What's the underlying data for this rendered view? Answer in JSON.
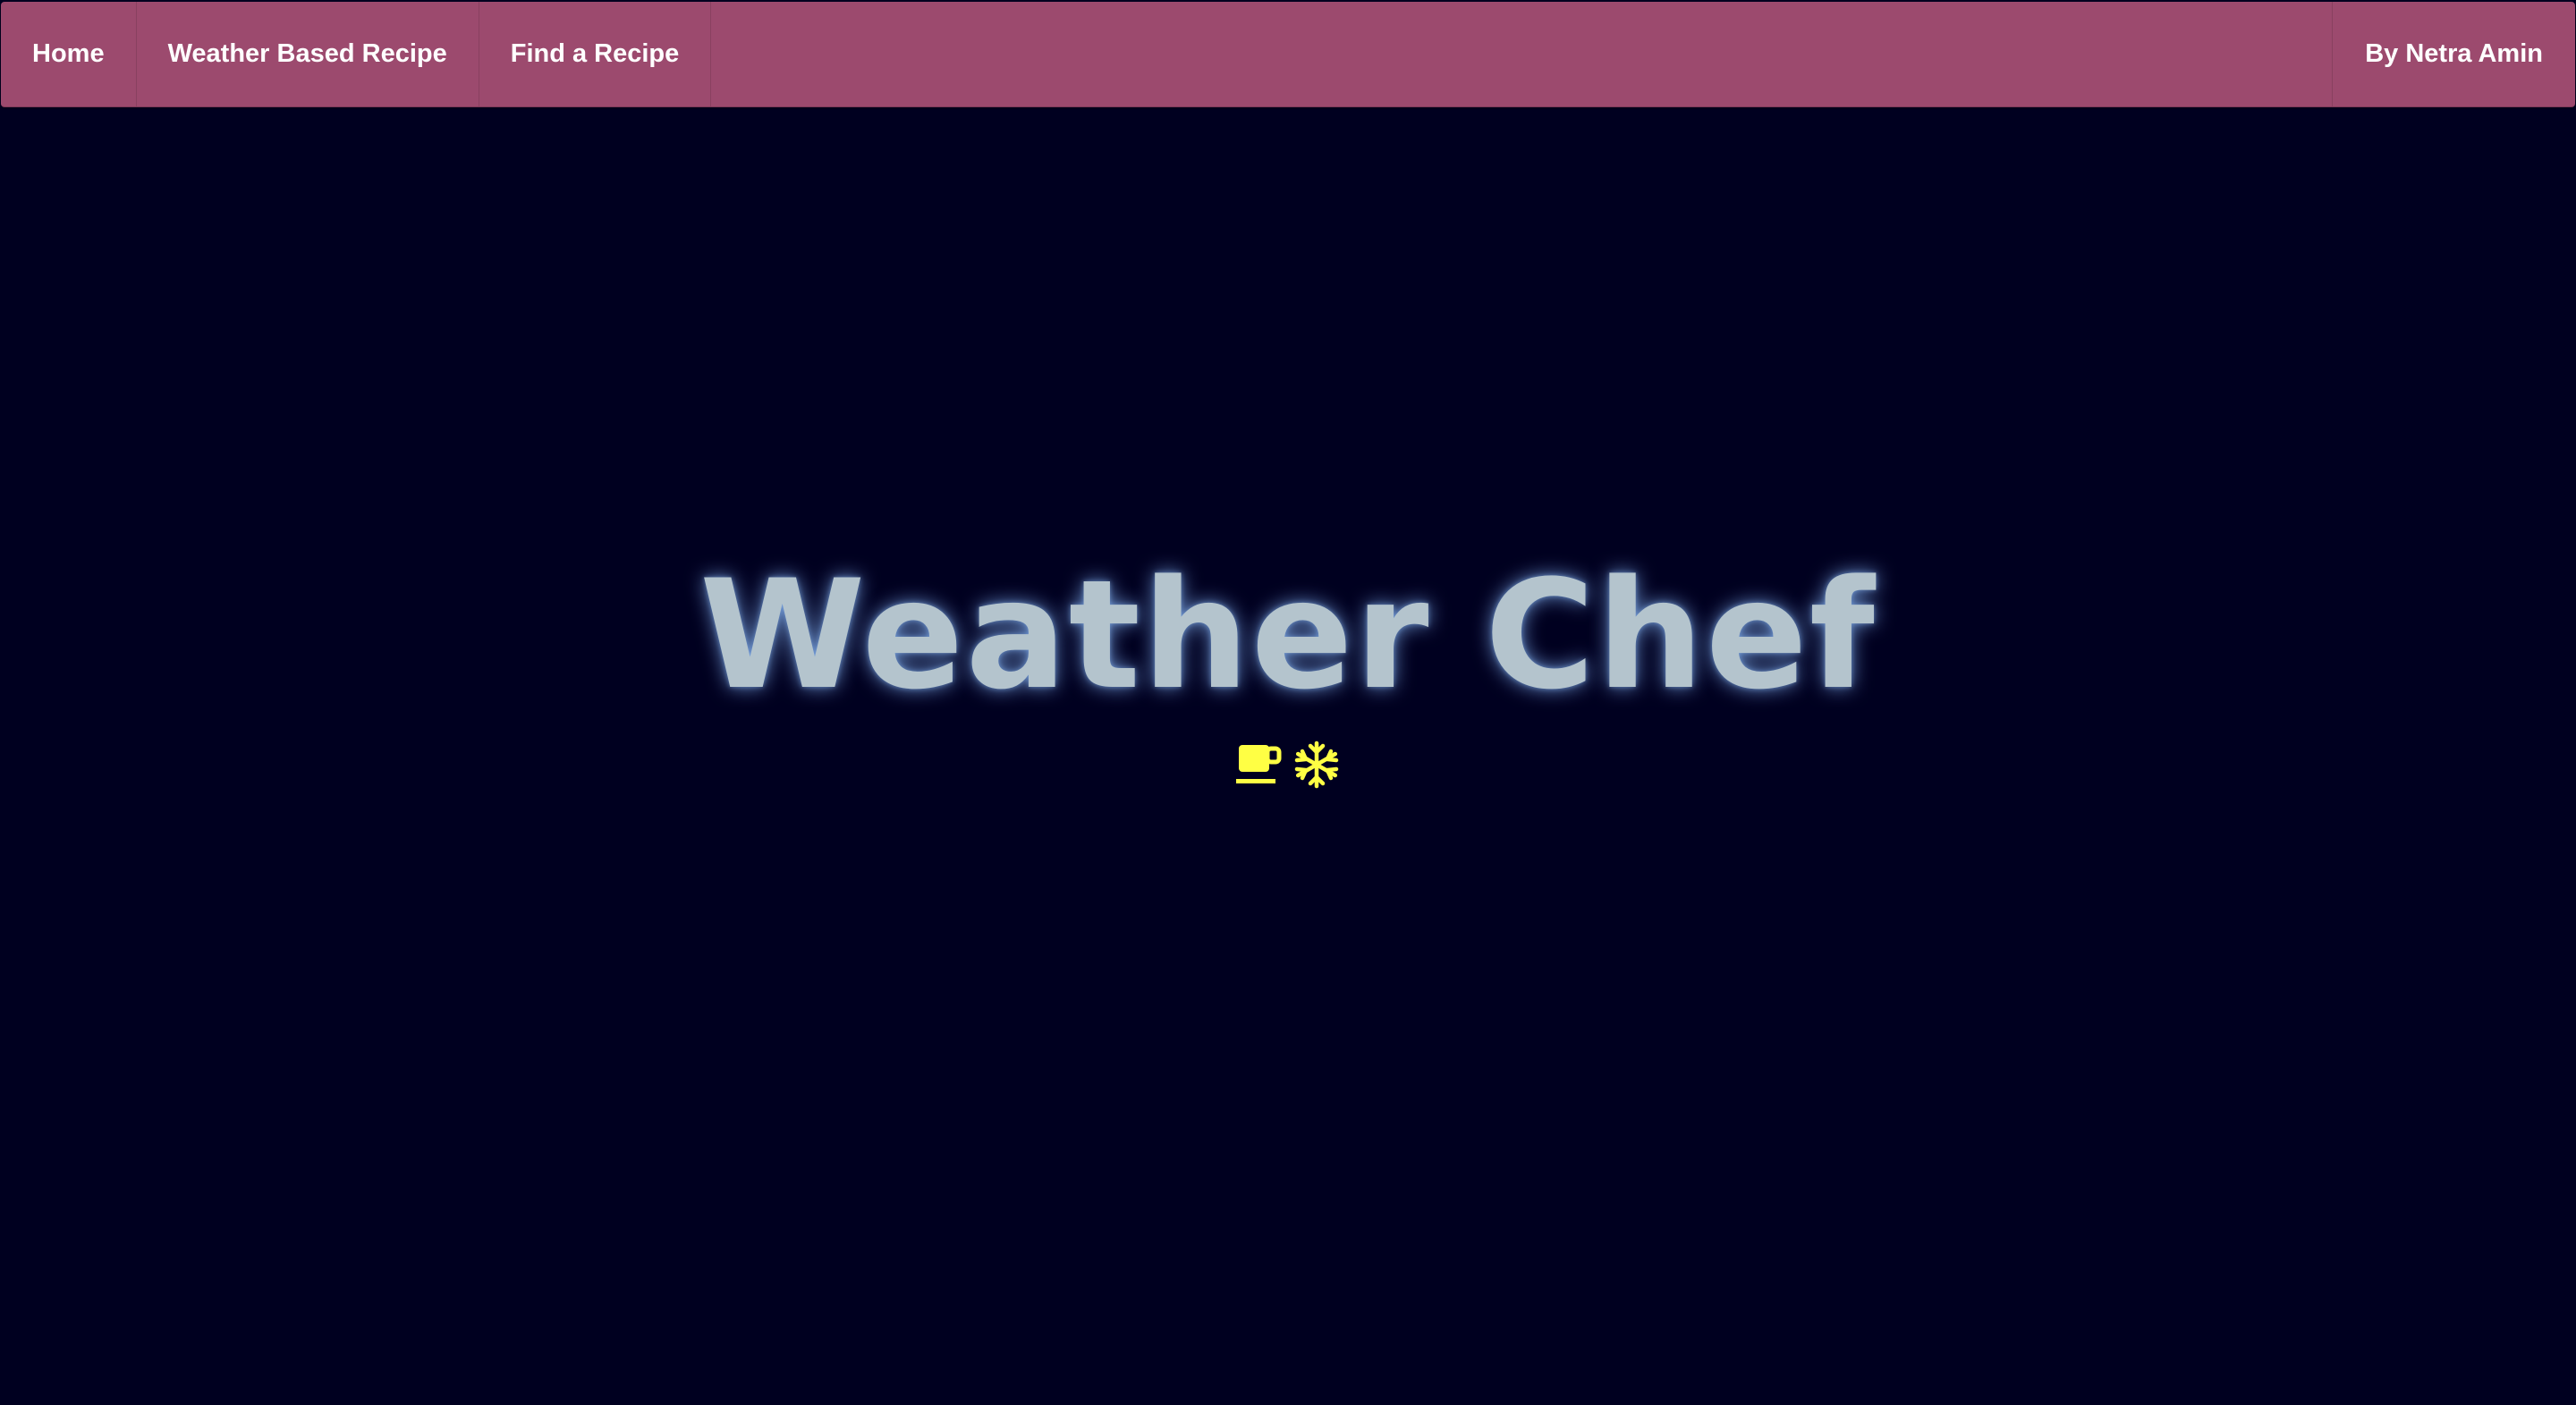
{
  "nav": {
    "items": [
      {
        "label": "Home"
      },
      {
        "label": "Weather Based Recipe"
      },
      {
        "label": "Find a Recipe"
      }
    ],
    "author": "By Netra Amin"
  },
  "hero": {
    "title": "Weather Chef",
    "icons": [
      "coffee-cup-icon",
      "snowflake-icon"
    ]
  },
  "colors": {
    "navbar": "#9c4a6e",
    "background": "#000020",
    "title": "#b4c4cd",
    "icon": "#ffff44"
  }
}
